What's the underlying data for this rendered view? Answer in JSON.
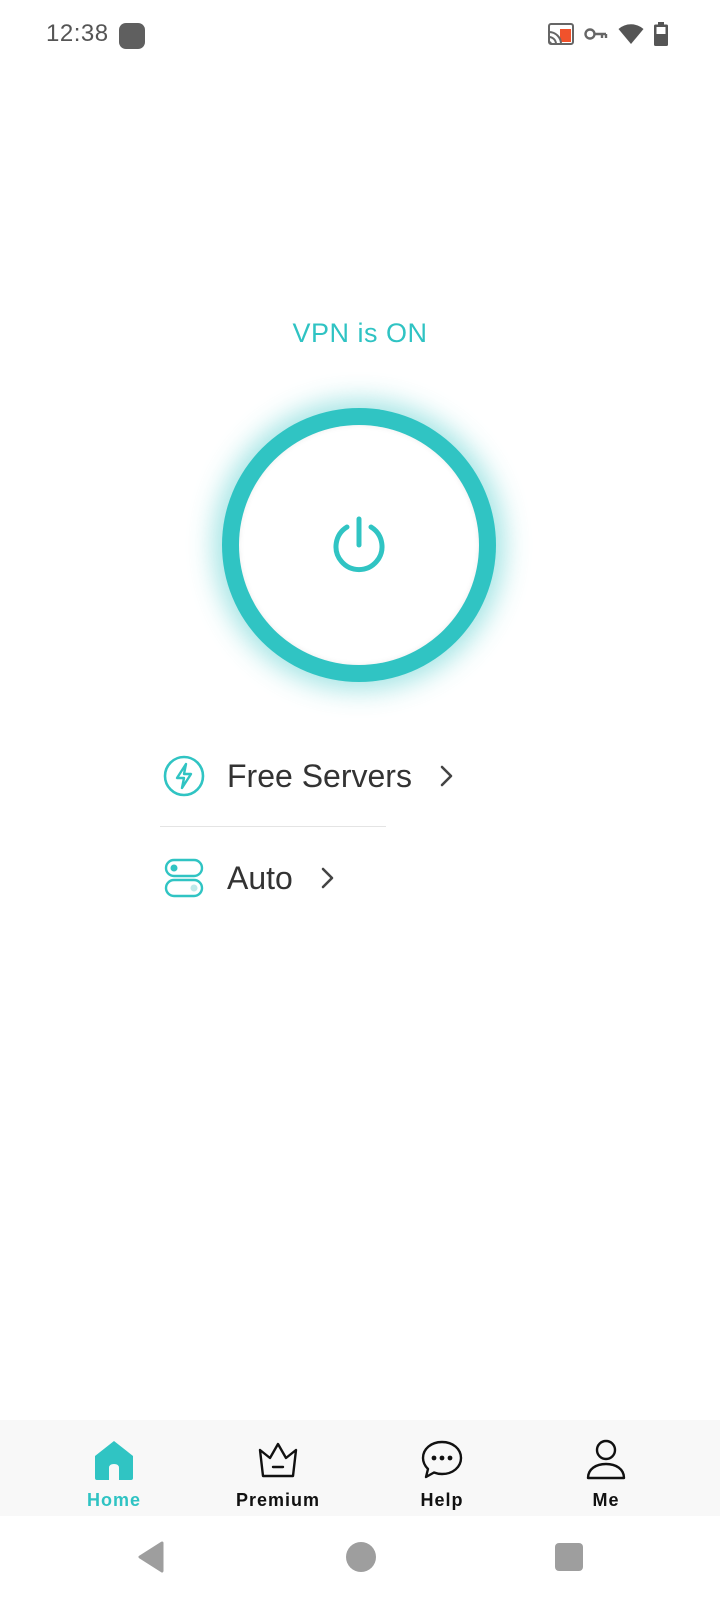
{
  "status_bar": {
    "time": "12:38",
    "icons": [
      "cast-icon",
      "vpn-key-icon",
      "wifi-icon",
      "battery-icon"
    ]
  },
  "vpn": {
    "status_text": "VPN is ON",
    "power_icon": "power-icon"
  },
  "options": [
    {
      "label": "Free Servers",
      "icon": "lightning-icon"
    },
    {
      "label": "Auto",
      "icon": "toggle-icon"
    }
  ],
  "bottom_nav": {
    "items": [
      {
        "label": "Home",
        "icon": "home-icon",
        "active": true
      },
      {
        "label": "Premium",
        "icon": "crown-icon",
        "active": false
      },
      {
        "label": "Help",
        "icon": "chat-icon",
        "active": false
      },
      {
        "label": "Me",
        "icon": "user-icon",
        "active": false
      }
    ]
  },
  "colors": {
    "accent": "#2fc3c3",
    "text": "#333333",
    "nav_background": "#f8f8f8"
  }
}
